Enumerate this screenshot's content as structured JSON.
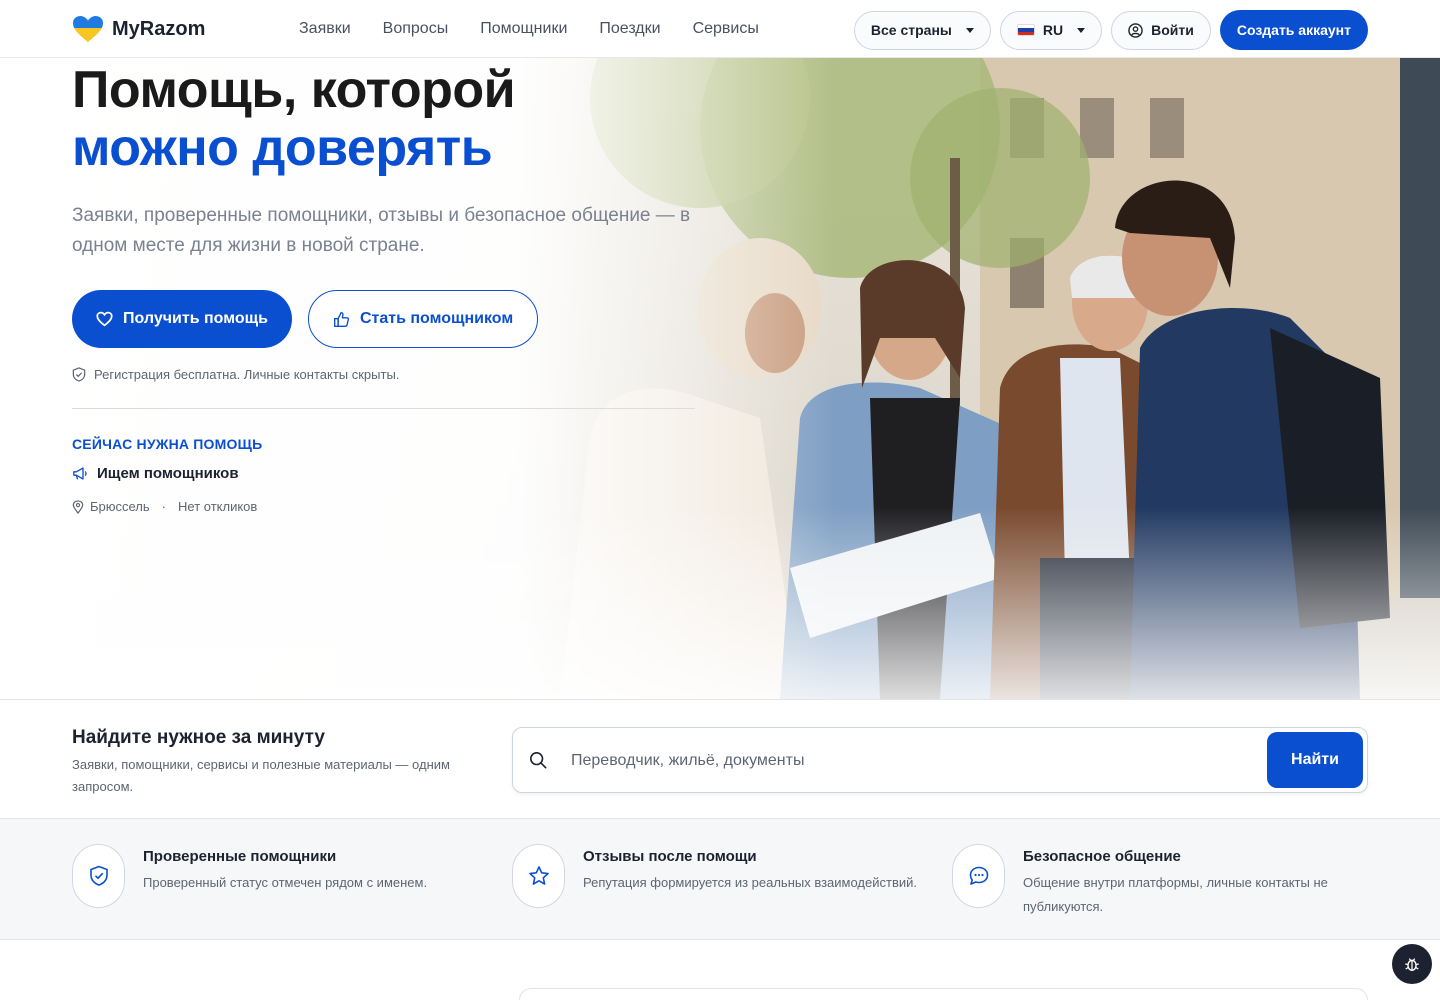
{
  "brand": {
    "name": "MyRazom"
  },
  "nav": {
    "items": [
      {
        "label": "Заявки"
      },
      {
        "label": "Вопросы"
      },
      {
        "label": "Помощники"
      },
      {
        "label": "Поездки"
      },
      {
        "label": "Сервисы"
      }
    ]
  },
  "header": {
    "country_label": "Все страны",
    "language_label": "RU",
    "login_label": "Войти",
    "create_account_label": "Создать аккаунт"
  },
  "hero": {
    "title_line1": "Помощь, которой",
    "title_line2": "можно доверять",
    "lead": "Заявки, проверенные помощники, отзывы и безопасное общение — в одном месте для жизни в новой стране.",
    "primary_button": "Получить помощь",
    "secondary_button": "Стать помощником",
    "note": "Регистрация бесплатна. Личные контакты скрыты.",
    "now_title": "СЕЙЧАС НУЖНА ПОМОЩЬ",
    "now_item": "Ищем помощников",
    "now_location": "Брюссель",
    "now_separator": "·",
    "now_responses": "Нет откликов"
  },
  "search": {
    "title": "Найдите нужное за минуту",
    "subtitle": "Заявки, помощники, сервисы и полезные материалы — одним запросом.",
    "placeholder": "Переводчик, жильё, документы",
    "button": "Найти"
  },
  "features": [
    {
      "icon": "shield-check-icon",
      "title": "Проверенные помощники",
      "desc": "Проверенный статус отмечен рядом с именем."
    },
    {
      "icon": "star-icon",
      "title": "Отзывы после помощи",
      "desc": "Репутация формируется из реальных взаимодействий."
    },
    {
      "icon": "chat-bubble-icon",
      "title": "Безопасное общение",
      "desc": "Общение внутри платформы, личные контакты не публикуются."
    }
  ],
  "colors": {
    "accent": "#0b4fd1",
    "text": "#1d2230",
    "muted": "#5e6572"
  }
}
